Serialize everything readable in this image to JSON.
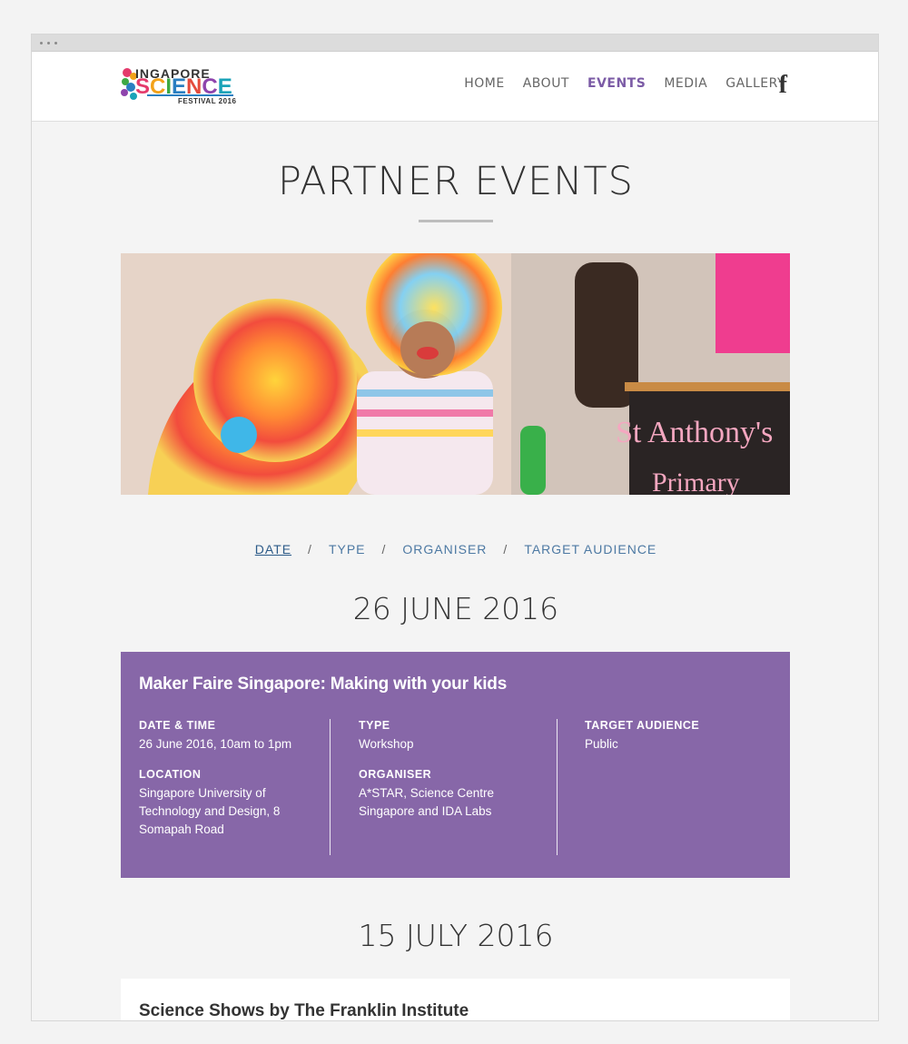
{
  "header": {
    "logo": {
      "line1": "INGAPORE",
      "line2_letters": [
        {
          "ch": "S",
          "color": "#e43b6c"
        },
        {
          "ch": "C",
          "color": "#f3a21a"
        },
        {
          "ch": "I",
          "color": "#3da944"
        },
        {
          "ch": "E",
          "color": "#2a7fc1"
        },
        {
          "ch": "N",
          "color": "#e54b3c"
        },
        {
          "ch": "C",
          "color": "#8e44ad"
        },
        {
          "ch": "E",
          "color": "#1aa3b8"
        }
      ],
      "line3": "FESTIVAL 2016"
    },
    "nav": [
      {
        "label": "HOME",
        "active": false
      },
      {
        "label": "ABOUT",
        "active": false
      },
      {
        "label": "EVENTS",
        "active": true
      },
      {
        "label": "MEDIA",
        "active": false
      },
      {
        "label": "GALLERY",
        "active": false
      }
    ],
    "social_icon": "facebook-icon",
    "social_glyph": "f"
  },
  "page": {
    "title": "PARTNER EVENTS"
  },
  "hero": {
    "sign_text_line1": "St Anthony's",
    "sign_text_line2": "Primary"
  },
  "filters": {
    "items": [
      "DATE",
      "TYPE",
      "ORGANISER",
      "TARGET AUDIENCE"
    ],
    "active": "DATE",
    "separator": "/"
  },
  "sections": [
    {
      "date": "26 JUNE 2016",
      "event": {
        "title": "Maker Faire Singapore: Making with your kids",
        "date_time_label": "DATE & TIME",
        "date_time": "26 June 2016, 10am to 1pm",
        "location_label": "LOCATION",
        "location": "Singapore University of Technology and Design, 8 Somapah Road",
        "type_label": "TYPE",
        "type": "Workshop",
        "organiser_label": "ORGANISER",
        "organiser": "A*STAR, Science Centre Singapore and IDA Labs",
        "audience_label": "TARGET AUDIENCE",
        "audience": "Public",
        "card_color": "#8767a8"
      }
    },
    {
      "date": "15 JULY 2016",
      "event": {
        "title": "Science Shows by The Franklin Institute"
      }
    }
  ],
  "colors": {
    "accent": "#7b5ba6",
    "link": "#4d79a3"
  }
}
